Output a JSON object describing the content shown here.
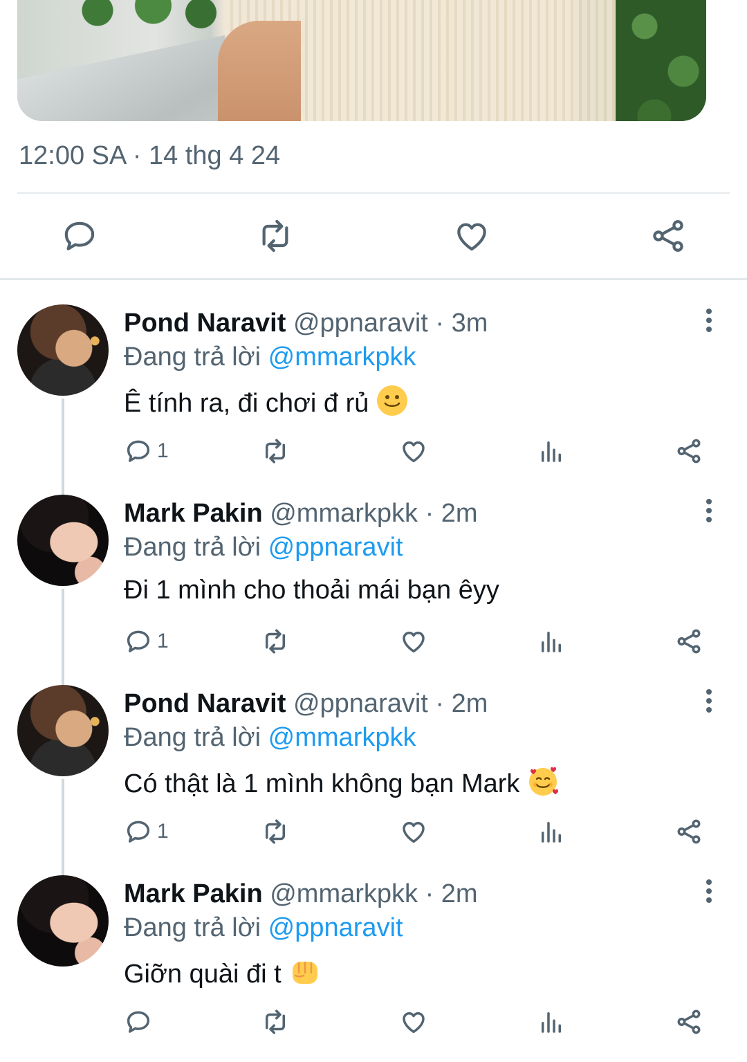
{
  "tweet": {
    "timestamp": "12:00 SA · 14 thg 4 24",
    "actions": [
      {
        "name": "reply",
        "icon": "reply-icon"
      },
      {
        "name": "retweet",
        "icon": "retweet-icon"
      },
      {
        "name": "like",
        "icon": "heart-icon"
      },
      {
        "name": "share",
        "icon": "share-icon"
      }
    ]
  },
  "replies": [
    {
      "display_name": "Pond Naravit",
      "handle_time": "@ppnaravit · 3m",
      "replying_prefix": "Đang trả lời",
      "replying_to": "@mmarkpkk",
      "text": "Ê tính ra, đi chơi đ rủ",
      "emoji": "slightly-smiling-face",
      "reply_count": "1"
    },
    {
      "display_name": "Mark Pakin",
      "handle_time": "@mmarkpkk · 2m",
      "replying_prefix": "Đang trả lời",
      "replying_to": "@ppnaravit",
      "text": "Đi 1 mình cho thoải mái bạn êyy",
      "emoji": "",
      "reply_count": "1"
    },
    {
      "display_name": "Pond Naravit",
      "handle_time": "@ppnaravit · 2m",
      "replying_prefix": "Đang trả lời",
      "replying_to": "@mmarkpkk",
      "text": "Có thật là 1 mình không bạn Mark",
      "emoji": "smiling-face-with-hearts",
      "reply_count": "1"
    },
    {
      "display_name": "Mark Pakin",
      "handle_time": "@mmarkpkk · 2m",
      "replying_prefix": "Đang trả lời",
      "replying_to": "@ppnaravit",
      "text": "Giỡn quài đi t",
      "emoji": "oncoming-fist",
      "reply_count": ""
    }
  ],
  "colors": {
    "text_primary": "#0f1419",
    "text_secondary": "#536471",
    "link": "#1d9bf0",
    "divider": "#e6eaed"
  }
}
